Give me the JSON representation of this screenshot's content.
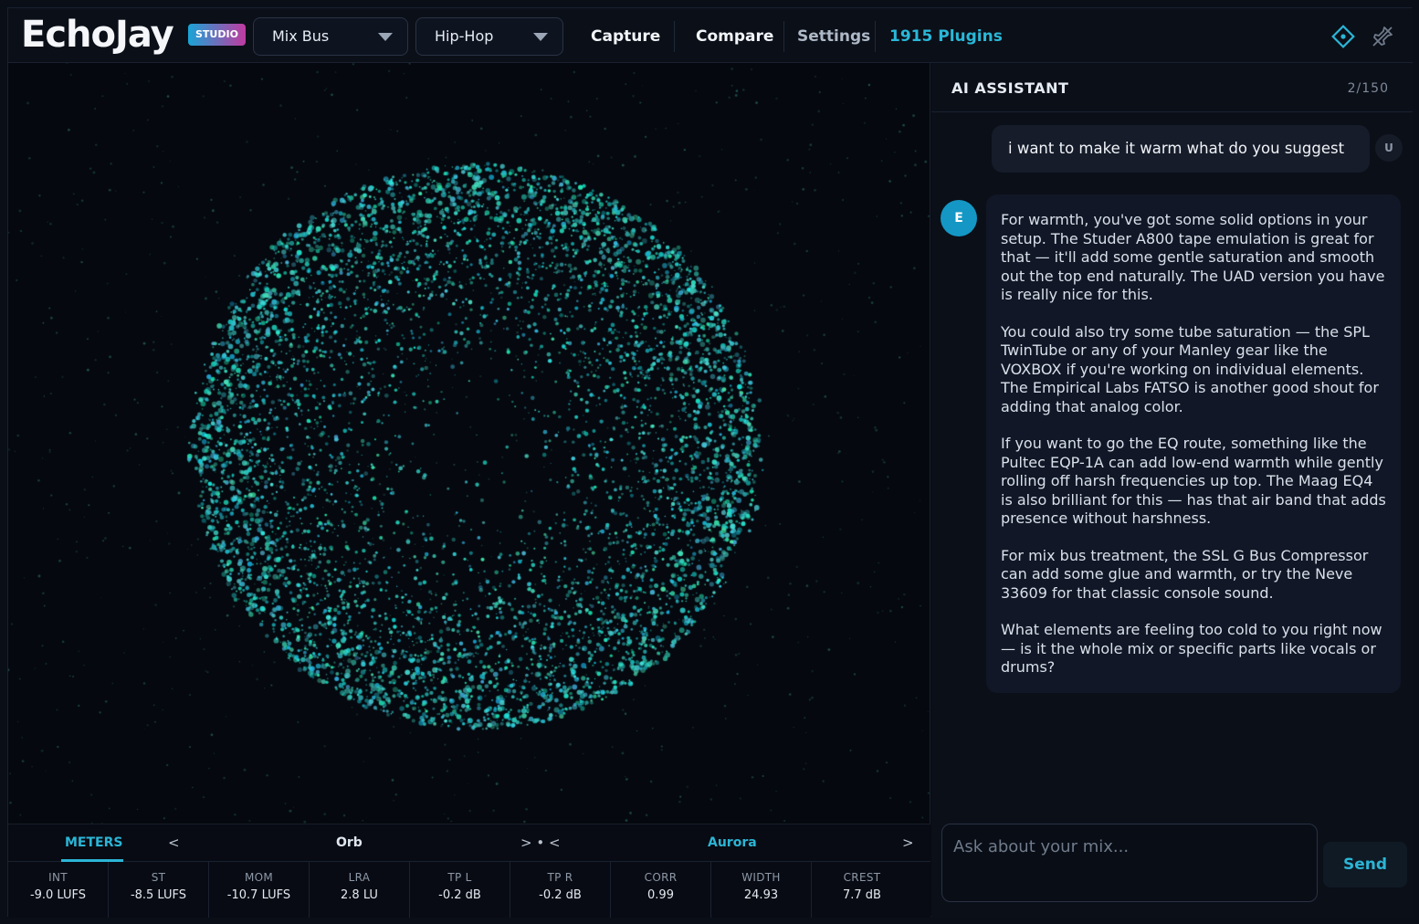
{
  "header": {
    "logo": "EchoJay",
    "badge": "STUDIO",
    "bus_select": "Mix Bus",
    "genre_select": "Hip-Hop",
    "nav_capture": "Capture",
    "nav_compare": "Compare",
    "nav_settings": "Settings",
    "nav_plugins": "1915 Plugins",
    "icons": [
      "diamond-icon",
      "unpin-icon"
    ],
    "accent_color": "#29b8d8"
  },
  "visualizer": {
    "mode": "Orb",
    "palette": "Aurora",
    "particle_color": "#26d4d0"
  },
  "meter_bar": {
    "tab": "METERS",
    "prev_arrow": "<",
    "mode_label": "Orb",
    "mid_nav": "> • <",
    "palette_label": "Aurora",
    "next_arrow": ">"
  },
  "meters": [
    {
      "label": "INT",
      "value": "-9.0 LUFS"
    },
    {
      "label": "ST",
      "value": "-8.5 LUFS"
    },
    {
      "label": "MOM",
      "value": "-10.7 LUFS"
    },
    {
      "label": "LRA",
      "value": "2.8 LU"
    },
    {
      "label": "TP L",
      "value": "-0.2 dB"
    },
    {
      "label": "TP R",
      "value": "-0.2 dB"
    },
    {
      "label": "CORR",
      "value": "0.99"
    },
    {
      "label": "WIDTH",
      "value": "24.93"
    },
    {
      "label": "CREST",
      "value": "7.7 dB"
    }
  ],
  "assistant": {
    "title": "AI ASSISTANT",
    "count": "2/150",
    "user_avatar": "U",
    "bot_avatar": "E",
    "user_message": "i want to make it warm what do you suggest",
    "bot_paragraphs": [
      "For warmth, you've got some solid options in your setup. The Studer A800 tape emulation is great for that — it'll add some gentle saturation and smooth out the top end naturally. The UAD version you have is really nice for this.",
      "You could also try some tube saturation — the SPL TwinTube or any of your Manley gear like the VOXBOX if you're working on individual elements. The Empirical Labs FATSO is another good shout for adding that analog color.",
      "If you want to go the EQ route, something like the Pultec EQP-1A can add low-end warmth while gently rolling off harsh frequencies up top. The Maag EQ4 is also brilliant for this — has that air band that adds presence without harshness.",
      "For mix bus treatment, the SSL G Bus Compressor can add some glue and warmth, or try the Neve 33609 for that classic console sound.",
      "What elements are feeling too cold to you right now — is it the whole mix or specific parts like vocals or drums?"
    ],
    "input_placeholder": "Ask about your mix...",
    "send_label": "Send"
  }
}
